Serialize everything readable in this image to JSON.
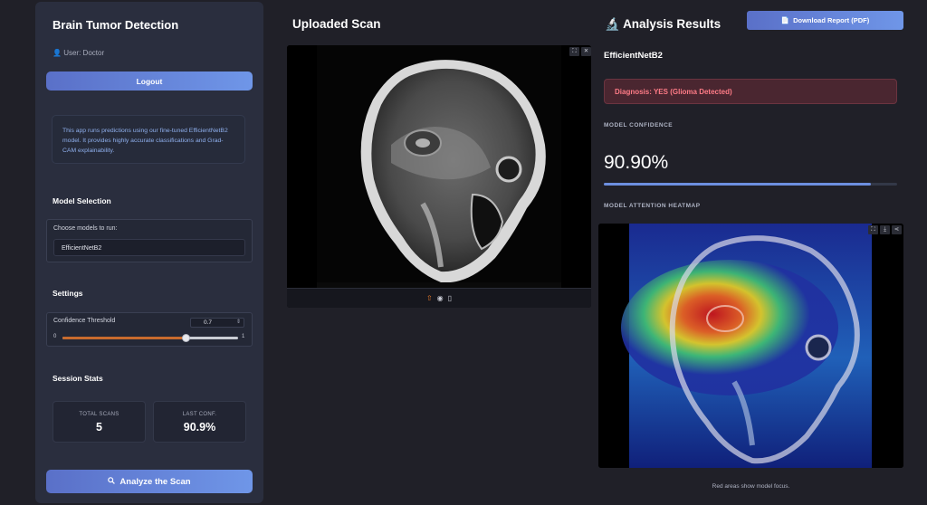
{
  "sidebar": {
    "title": "Brain Tumor Detection",
    "user_icon": "user-icon",
    "user_label": "User: Doctor",
    "logout_label": "Logout",
    "info_text": "This app runs predictions using our fine-tuned EfficientNetB2 model. It provides highly accurate classifications and Grad-CAM explainability.",
    "model_section": {
      "title": "Model Selection",
      "prompt": "Choose models to run:",
      "selected_model": "EfficientNetB2"
    },
    "settings": {
      "title": "Settings",
      "threshold_label": "Confidence Threshold",
      "threshold_value": "0.7",
      "threshold_numeric": 0.7,
      "slider_min": "0",
      "slider_max": "1"
    },
    "session_stats": {
      "title": "Session Stats",
      "total_scans_label": "TOTAL SCANS",
      "total_scans_value": "5",
      "last_conf_label": "LAST CONF.",
      "last_conf_value": "90.9%"
    },
    "analyze_icon": "magnifier-icon",
    "analyze_label": "Analyze the Scan"
  },
  "scan": {
    "title": "Uploaded Scan",
    "toolbar_icons": [
      "upload-icon",
      "webcam-icon",
      "clipboard-icon"
    ]
  },
  "results": {
    "title_icon": "microscope-icon",
    "title": "Analysis Results",
    "download_icon": "document-icon",
    "download_label": "Download Report (PDF)",
    "model_name": "EfficientNetB2",
    "diagnosis": "Diagnosis: YES (Glioma Detected)",
    "confidence_label": "MODEL CONFIDENCE",
    "confidence_value": "90.90%",
    "confidence_fraction": 0.909,
    "heatmap_label": "MODEL ATTENTION HEATMAP",
    "heatmap_caption": "Red areas show model focus."
  },
  "colors": {
    "accent": "#6f96e8",
    "danger_text": "#ff7b86",
    "danger_bg": "#4a2630",
    "slider_fill": "#c86b2e"
  }
}
